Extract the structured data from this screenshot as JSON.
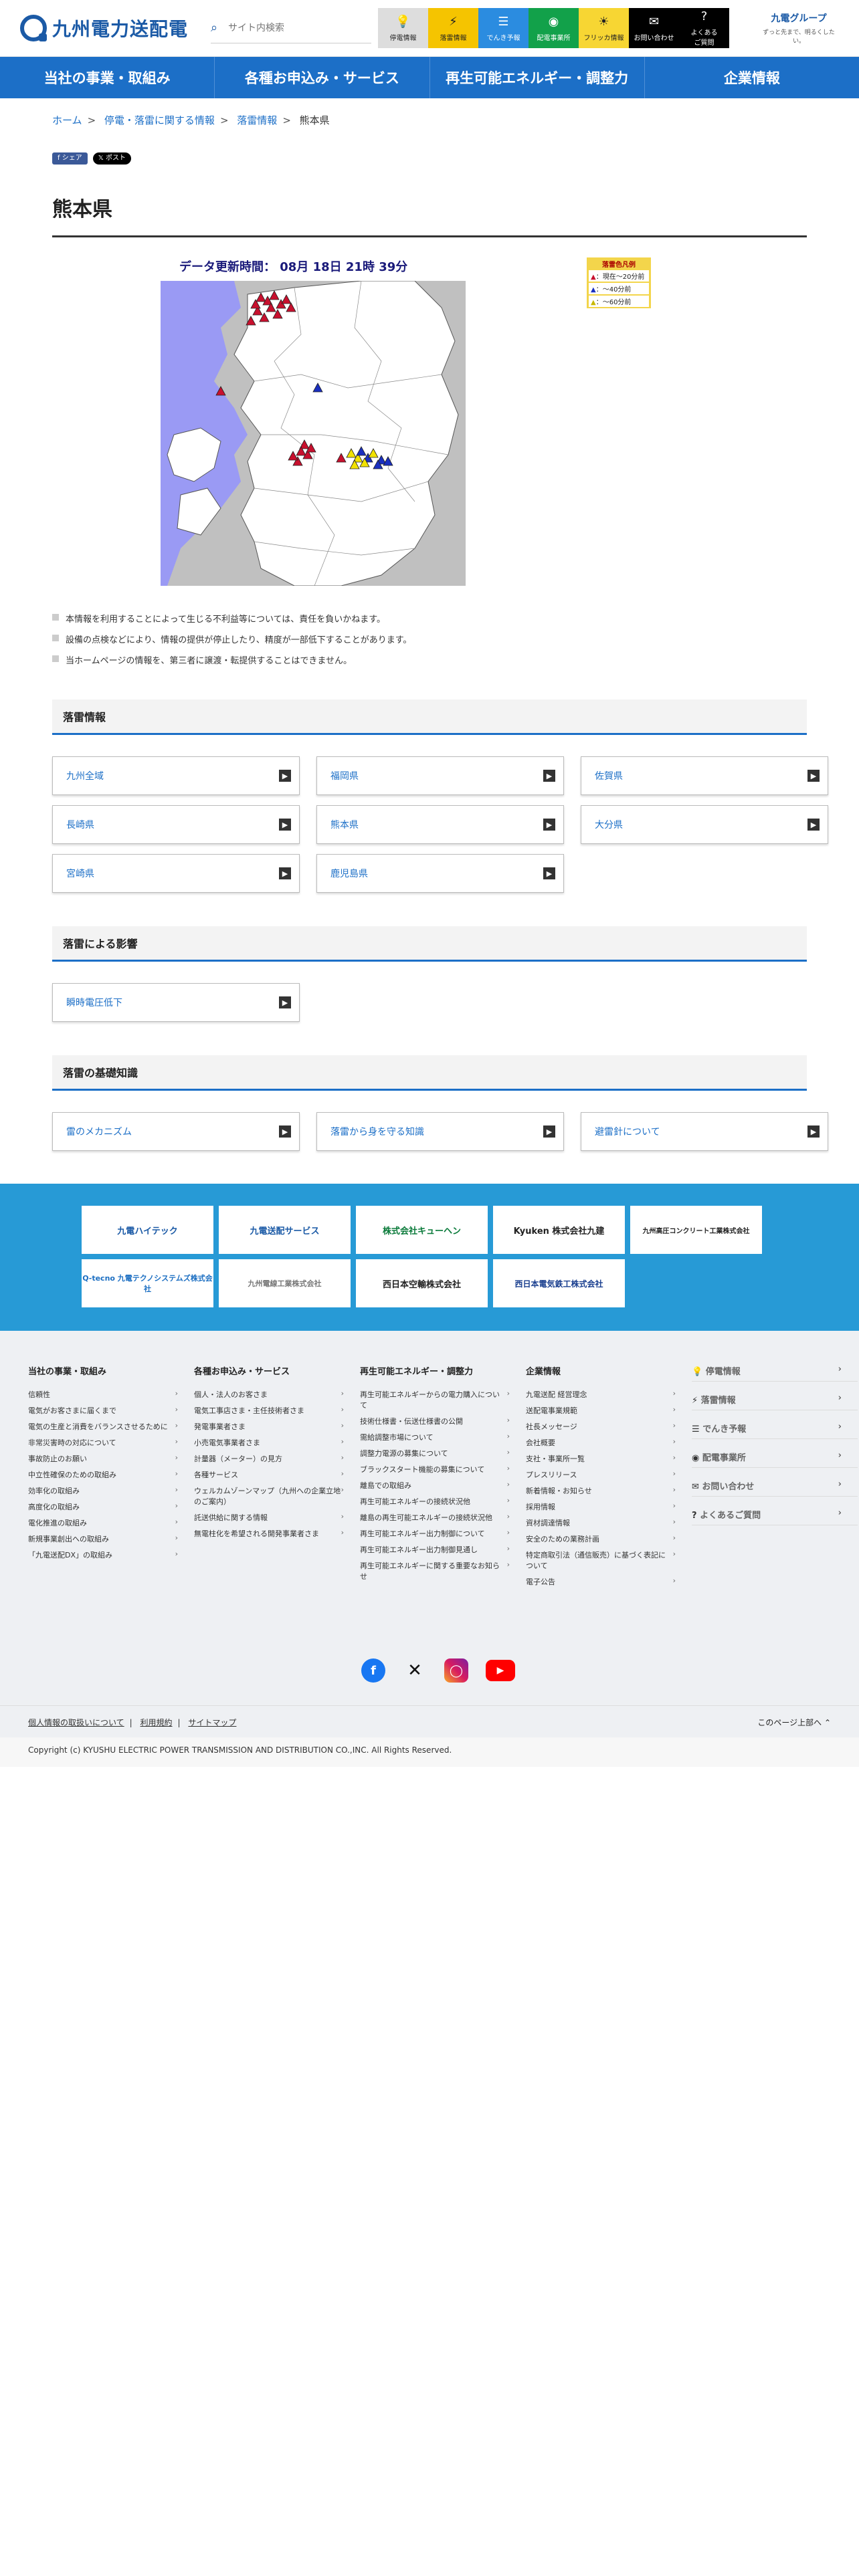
{
  "header": {
    "logo_text": "九州電力送配電",
    "search_placeholder": "サイト内検索",
    "quick": [
      {
        "label": "停電情報",
        "icon": "bulb-icon"
      },
      {
        "label": "落雷情報",
        "icon": "lightning-bulb-icon"
      },
      {
        "label": "でんき予報",
        "icon": "battery-icon"
      },
      {
        "label": "配電事業所",
        "icon": "location-icon"
      },
      {
        "label": "フリッカ情報",
        "icon": "flicker-icon"
      },
      {
        "label": "お問い合わせ",
        "icon": "mail-icon"
      },
      {
        "label": "よくあるご質問",
        "icon": "question-icon"
      }
    ],
    "group_name": "九電グループ",
    "group_tagline": "ずっと先まで、明るくしたい。"
  },
  "nav": [
    "当社の事業・取組み",
    "各種お申込み・サービス",
    "再生可能エネルギー・調整力",
    "企業情報"
  ],
  "breadcrumb": [
    "ホーム",
    "停電・落雷に関する情報",
    "落雷情報",
    "熊本県"
  ],
  "share": {
    "facebook": "シェア",
    "x": "ポスト"
  },
  "page_title": "熊本県",
  "map": {
    "updated": "データ更新時間： 08月 18日 21時 39分",
    "legend_title": "落雷色凡例",
    "legend": [
      "：現在～20分前",
      "：～40分前",
      "：～60分前"
    ],
    "colors": {
      "now": "#c8102e",
      "40": "#1a2fbf",
      "60": "#f2e200",
      "sea": "#9a9af4",
      "land": "#ffffff",
      "other": "#c0c0c0"
    }
  },
  "notes": [
    "本情報を利用することによって生じる不利益等については、責任を負いかねます。",
    "設備の点検などにより、情報の提供が停止したり、精度が一部低下することがあります。",
    "当ホームページの情報を、第三者に譲渡・転提供することはできません。"
  ],
  "sections": [
    {
      "title": "落雷情報",
      "items": [
        "九州全域",
        "福岡県",
        "佐賀県",
        "長崎県",
        "熊本県",
        "大分県",
        "宮崎県",
        "鹿児島県"
      ]
    },
    {
      "title": "落雷による影響",
      "items": [
        "瞬時電圧低下"
      ]
    },
    {
      "title": "落雷の基礎知識",
      "items": [
        "雷のメカニズム",
        "落雷から身を守る知識",
        "避雷針について"
      ]
    }
  ],
  "partners": [
    "九電ハイテック",
    "九電送配サービス",
    "株式会社キューヘン",
    "Kyuken 株式会社九建",
    "九州高圧コンクリート工業株式会社",
    "Q-tecno 九電テクノシステムズ株式会社",
    "九州電線工業株式会社",
    "西日本空輸株式会社",
    "西日本電気鉄工株式会社"
  ],
  "footer": {
    "cols": [
      {
        "title": "当社の事業・取組み",
        "items": [
          "信頼性",
          "電気がお客さまに届くまで",
          "電気の生産と消費をバランスさせるために",
          "非常災害時の対応について",
          "事故防止のお願い",
          "中立性確保のための取組み",
          "効率化の取組み",
          "高度化の取組み",
          "電化推進の取組み",
          "新規事業創出への取組み",
          "「九電送配DX」の取組み"
        ]
      },
      {
        "title": "各種お申込み・サービス",
        "items": [
          "個人・法人のお客さま",
          "電気工事店さま・主任技術者さま",
          "発電事業者さま",
          "小売電気事業者さま",
          "計量器（メーター）の見方",
          "各種サービス",
          "ウェルカムゾーンマップ（九州への企業立地のご案内）",
          "託送供給に関する情報",
          "無電柱化を希望される開発事業者さま"
        ]
      },
      {
        "title": "再生可能エネルギー・調整力",
        "items": [
          "再生可能エネルギーからの電力購入について",
          "技術仕様書・伝送仕様書の公開",
          "需給調整市場について",
          "調整力電源の募集について",
          "ブラックスタート機能の募集について",
          "離島での取組み",
          "再生可能エネルギーの接続状況他",
          "離島の再生可能エネルギーの接続状況他",
          "再生可能エネルギー出力制御について",
          "再生可能エネルギー出力制御見通し",
          "再生可能エネルギーに関する重要なお知らせ"
        ]
      },
      {
        "title": "企業情報",
        "items": [
          "九電送配 経営理念",
          "送配電事業規範",
          "社長メッセージ",
          "会社概要",
          "支社・事業所一覧",
          "プレスリリース",
          "新着情報・お知らせ",
          "採用情報",
          "資材調達情報",
          "安全のための業務計画",
          "特定商取引法（通信販売）に基づく表記について",
          "電子公告"
        ]
      }
    ],
    "quick": [
      "停電情報",
      "落雷情報",
      "でんき予報",
      "配電事業所",
      "お問い合わせ",
      "よくあるご質問"
    ],
    "links": [
      "個人情報の取扱いについて",
      "利用規約",
      "サイトマップ"
    ],
    "to_top": "このページ上部へ",
    "copyright": "Copyright (c) KYUSHU ELECTRIC POWER TRANSMISSION AND DISTRIBUTION CO.,INC. All Rights Reserved."
  }
}
